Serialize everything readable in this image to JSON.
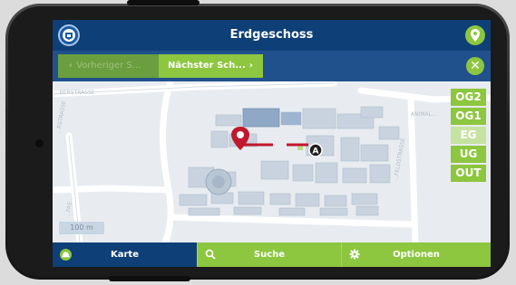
{
  "header": {
    "title": "Erdgeschoss",
    "logo_icon": "university-seal-icon",
    "location_icon": "map-pin-icon"
  },
  "navigation": {
    "previous_label": "Vorheriger S...",
    "next_label": "Nächster Sch...",
    "close_icon": "close-icon"
  },
  "map": {
    "marker_label": "A",
    "scale_label": "100 m",
    "street_labels": [
      "...BERSTRASSE",
      "...RSTRASSE",
      "...FAS...",
      "ANIMAL...",
      "...FELDSTRASSE"
    ],
    "floors": [
      {
        "label": "OG2",
        "active": false
      },
      {
        "label": "OG1",
        "active": false
      },
      {
        "label": "EG",
        "active": true
      },
      {
        "label": "UG",
        "active": false
      },
      {
        "label": "OUT",
        "active": false
      }
    ]
  },
  "tabs": [
    {
      "label": "Karte",
      "icon": "helmet-icon",
      "active": true
    },
    {
      "label": "Suche",
      "icon": "search-icon",
      "active": false
    },
    {
      "label": "Optionen",
      "icon": "gear-icon",
      "active": false
    }
  ],
  "colors": {
    "navy": "#0e3f76",
    "green": "#8dc63f",
    "route_red": "#c0182d"
  }
}
